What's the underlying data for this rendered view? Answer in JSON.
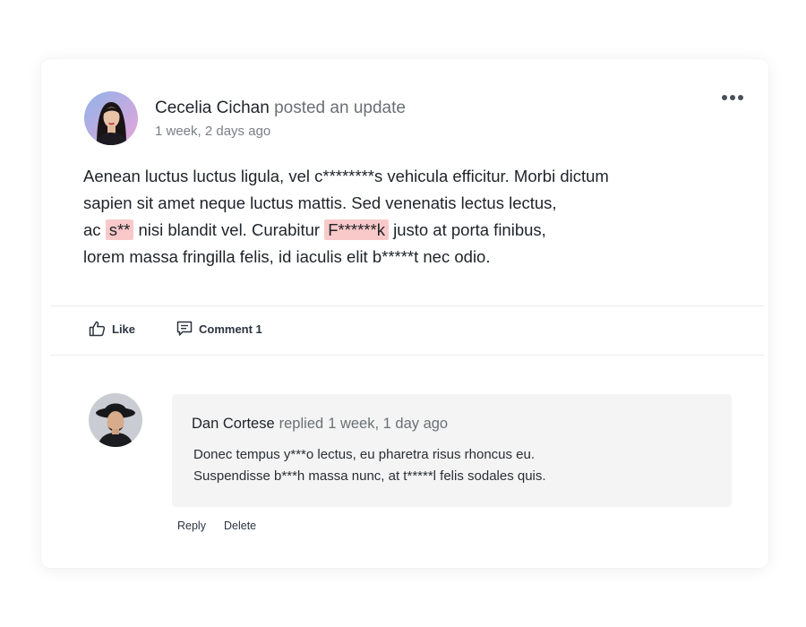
{
  "post": {
    "author": "Cecelia Cichan",
    "action": "posted an update",
    "time": "1 week, 2 days ago",
    "body": {
      "l1": "Aenean luctus luctus ligula, vel c********s vehicula efficitur. Morbi dictum",
      "l2": "sapien sit amet neque luctus mattis. Sed venenatis lectus lectus,",
      "l3_a": "ac ",
      "l3_flag1": "s**",
      "l3_b": " nisi blandit vel. Curabitur ",
      "l3_flag2": "F******k",
      "l3_c": " justo at porta finibus,",
      "l4": "lorem massa fringilla felis, id iaculis elit b*****t nec odio."
    },
    "flag_color": "#f9c9c9"
  },
  "actions": {
    "like_label": "Like",
    "comment_label": "Comment 1",
    "more_icon": "more-horizontal-icon"
  },
  "comment": {
    "author": "Dan Cortese",
    "action": "replied",
    "time": "1 week, 1 day ago",
    "text": {
      "l1": "Donec tempus y***o lectus, eu pharetra risus rhoncus eu.",
      "l2": "Suspendisse b***h massa nunc, at t*****l felis sodales quis."
    },
    "reply_label": "Reply",
    "delete_label": "Delete"
  }
}
